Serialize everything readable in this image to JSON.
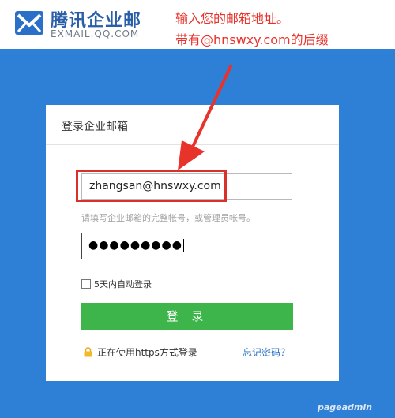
{
  "header": {
    "logo_cn": "腾讯企业邮",
    "logo_en": "EXMAIL.QQ.COM",
    "brand_color": "#2a5fa8"
  },
  "annotation": {
    "line1": "输入您的邮箱地址。",
    "line2": "带有@hnswxy.com的后缀",
    "color": "#e8332b"
  },
  "login": {
    "title": "登录企业邮箱",
    "email_value": "zhangsan@hnswxy.com",
    "email_hint": "请填写企业邮箱的完整帐号，或管理员帐号。",
    "password_value": "●●●●●●●●●",
    "remember_label": "5天内自动登录",
    "remember_checked": false,
    "button_label": "登 录",
    "https_label": "正在使用https方式登录",
    "forgot_label": "忘记密码？"
  },
  "watermark": "pageadmin",
  "colors": {
    "background_blue": "#2e7fd6",
    "button_green": "#3db54a",
    "link_blue": "#2a6fc0",
    "highlight_red": "#d9302c"
  }
}
